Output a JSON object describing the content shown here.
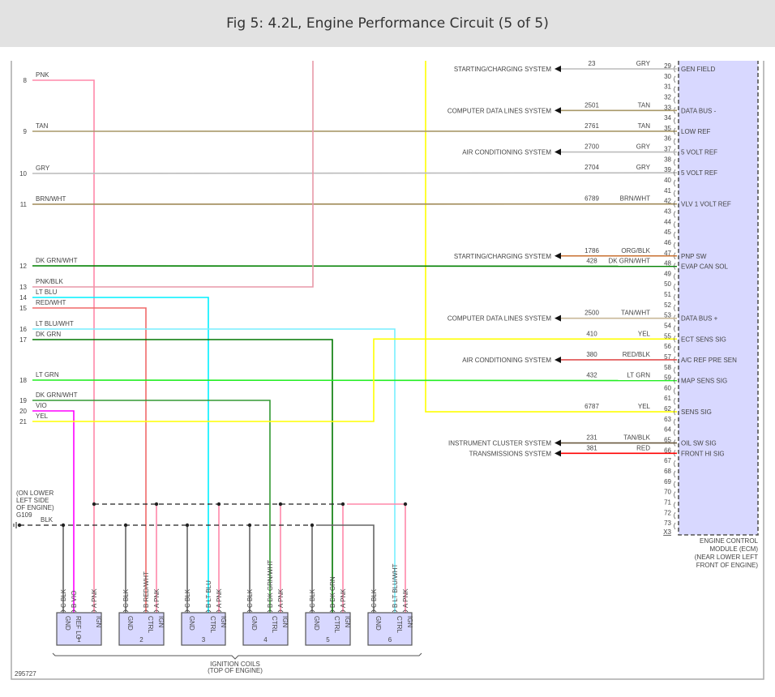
{
  "header": {
    "title": "Fig 5: 4.2L, Engine Performance Circuit (5 of 5)"
  },
  "left_connector": {
    "pins": [
      {
        "pin": "8",
        "wire": "PNK",
        "hex": "#ff88aa"
      },
      {
        "pin": "9",
        "wire": "TAN",
        "hex": "#a89868"
      },
      {
        "pin": "10",
        "wire": "GRY",
        "hex": "#bbbbbb"
      },
      {
        "pin": "11",
        "wire": "BRN/WHT",
        "hex": "#a08a58"
      },
      {
        "pin": "12",
        "wire": "DK GRN/WHT",
        "hex": "#008000"
      },
      {
        "pin": "13",
        "wire": "PNK/BLK",
        "hex": "#e899a8"
      },
      {
        "pin": "14",
        "wire": "LT BLU",
        "hex": "#00f0ff"
      },
      {
        "pin": "15",
        "wire": "RED/WHT",
        "hex": "#f06a6a"
      },
      {
        "pin": "16",
        "wire": "LT BLU/WHT",
        "hex": "#77eeff"
      },
      {
        "pin": "17",
        "wire": "DK GRN",
        "hex": "#007700"
      },
      {
        "pin": "18",
        "wire": "LT GRN",
        "hex": "#22ee22"
      },
      {
        "pin": "19",
        "wire": "DK GRN/WHT",
        "hex": "#339933"
      },
      {
        "pin": "20",
        "wire": "VIO",
        "hex": "#ff00ff"
      },
      {
        "pin": "21",
        "wire": "YEL",
        "hex": "#ffff00"
      }
    ]
  },
  "ecm": {
    "pin_numbers": [
      "29",
      "30",
      "31",
      "32",
      "33",
      "34",
      "35",
      "36",
      "37",
      "38",
      "39",
      "40",
      "41",
      "42",
      "43",
      "44",
      "45",
      "46",
      "47",
      "48",
      "49",
      "50",
      "51",
      "52",
      "53",
      "54",
      "55",
      "56",
      "57",
      "58",
      "59",
      "60",
      "61",
      "62",
      "63",
      "64",
      "65",
      "66",
      "67",
      "68",
      "69",
      "70",
      "71",
      "72",
      "73"
    ],
    "connector_id": "X3",
    "label": [
      "ENGINE CONTROL",
      "MODULE (ECM)",
      "(NEAR LOWER LEFT",
      "FRONT OF ENGINE)"
    ],
    "fill": "#d8d8ff",
    "circuits": [
      {
        "pin": "29",
        "circuit": "23",
        "wire": "GRY",
        "function": "GEN FIELD",
        "system": "STARTING/CHARGING SYSTEM",
        "hex": "#bbbbbb"
      },
      {
        "pin": "33",
        "circuit": "2501",
        "wire": "TAN",
        "function": "DATA BUS -",
        "system": "COMPUTER DATA LINES SYSTEM",
        "hex": "#a89868"
      },
      {
        "pin": "35",
        "circuit": "2761",
        "wire": "TAN",
        "function": "LOW REF",
        "system": "",
        "hex": "#a89868"
      },
      {
        "pin": "37",
        "circuit": "2700",
        "wire": "GRY",
        "function": "5 VOLT REF",
        "system": "AIR CONDITIONING SYSTEM",
        "hex": "#bbbbbb"
      },
      {
        "pin": "39",
        "circuit": "2704",
        "wire": "GRY",
        "function": "5 VOLT REF",
        "system": "",
        "hex": "#bbbbbb"
      },
      {
        "pin": "42",
        "circuit": "6789",
        "wire": "BRN/WHT",
        "function": "VLV 1 VOLT REF",
        "system": "",
        "hex": "#a08a58"
      },
      {
        "pin": "47",
        "circuit": "1786",
        "wire": "ORG/BLK",
        "function": "PNP SW",
        "system": "STARTING/CHARGING SYSTEM",
        "hex": "#c87030"
      },
      {
        "pin": "48",
        "circuit": "428",
        "wire": "DK GRN/WHT",
        "function": "EVAP CAN SOL",
        "system": "",
        "hex": "#008000"
      },
      {
        "pin": "53",
        "circuit": "2500",
        "wire": "TAN/WHT",
        "function": "DATA BUS +",
        "system": "COMPUTER DATA LINES SYSTEM",
        "hex": "#c8b898"
      },
      {
        "pin": "55",
        "circuit": "410",
        "wire": "YEL",
        "function": "ECT SENS SIG",
        "system": "",
        "hex": "#ffff00"
      },
      {
        "pin": "57",
        "circuit": "380",
        "wire": "RED/BLK",
        "function": "A/C REF PRE SEN",
        "system": "AIR CONDITIONING SYSTEM",
        "hex": "#e05050"
      },
      {
        "pin": "59",
        "circuit": "432",
        "wire": "LT GRN",
        "function": "MAP SENS SIG",
        "system": "",
        "hex": "#22ee22"
      },
      {
        "pin": "62",
        "circuit": "6787",
        "wire": "YEL",
        "function": "SENS SIG",
        "system": "",
        "hex": "#ffff00"
      },
      {
        "pin": "65",
        "circuit": "231",
        "wire": "TAN/BLK",
        "function": "OIL SW SIG",
        "system": "INSTRUMENT CLUSTER SYSTEM",
        "hex": "#6a5a40"
      },
      {
        "pin": "66",
        "circuit": "381",
        "wire": "RED",
        "function": "FRONT HI SIG",
        "system": "TRANSMISSIONS SYSTEM",
        "hex": "#ff0000"
      }
    ]
  },
  "ground": {
    "label": [
      "(ON LOWER",
      "LEFT SIDE",
      "OF ENGINE)",
      "G109"
    ],
    "wire": "BLK",
    "hex": "#666666"
  },
  "ignition_coils": {
    "label": [
      "IGNITION COILS",
      "(TOP OF ENGINE)"
    ],
    "fill": "#d8d8ff",
    "coils": [
      {
        "number": "1",
        "pins": [
          {
            "pin": "C",
            "wire": "BLK",
            "name": "GND"
          },
          {
            "pin": "B",
            "wire": "VIO",
            "name": "REF LO"
          },
          {
            "pin": "A",
            "wire": "PNK",
            "name": "IGN"
          }
        ]
      },
      {
        "number": "2",
        "pins": [
          {
            "pin": "C",
            "wire": "BLK",
            "name": "GND"
          },
          {
            "pin": "B",
            "wire": "RED/WHT",
            "name": "CTRL"
          },
          {
            "pin": "A",
            "wire": "PNK",
            "name": "IGN"
          }
        ]
      },
      {
        "number": "3",
        "pins": [
          {
            "pin": "C",
            "wire": "BLK",
            "name": "GND"
          },
          {
            "pin": "B",
            "wire": "LT BLU",
            "name": "CTRL"
          },
          {
            "pin": "A",
            "wire": "PNK",
            "name": "IGN"
          }
        ]
      },
      {
        "number": "4",
        "pins": [
          {
            "pin": "C",
            "wire": "BLK",
            "name": "GND"
          },
          {
            "pin": "B",
            "wire": "DK GRN/WHT",
            "name": "CTRL"
          },
          {
            "pin": "A",
            "wire": "PNK",
            "name": "IGN"
          }
        ]
      },
      {
        "number": "5",
        "pins": [
          {
            "pin": "C",
            "wire": "BLK",
            "name": "GND"
          },
          {
            "pin": "B",
            "wire": "DK GRN",
            "name": "CTRL"
          },
          {
            "pin": "A",
            "wire": "PNK",
            "name": "IGN"
          }
        ]
      },
      {
        "number": "6",
        "pins": [
          {
            "pin": "C",
            "wire": "BLK",
            "name": "GND"
          },
          {
            "pin": "B",
            "wire": "LT BLU/WHT",
            "name": "CTRL"
          },
          {
            "pin": "A",
            "wire": "PNK",
            "name": "IGN"
          }
        ]
      }
    ]
  },
  "figure_id": "295727"
}
